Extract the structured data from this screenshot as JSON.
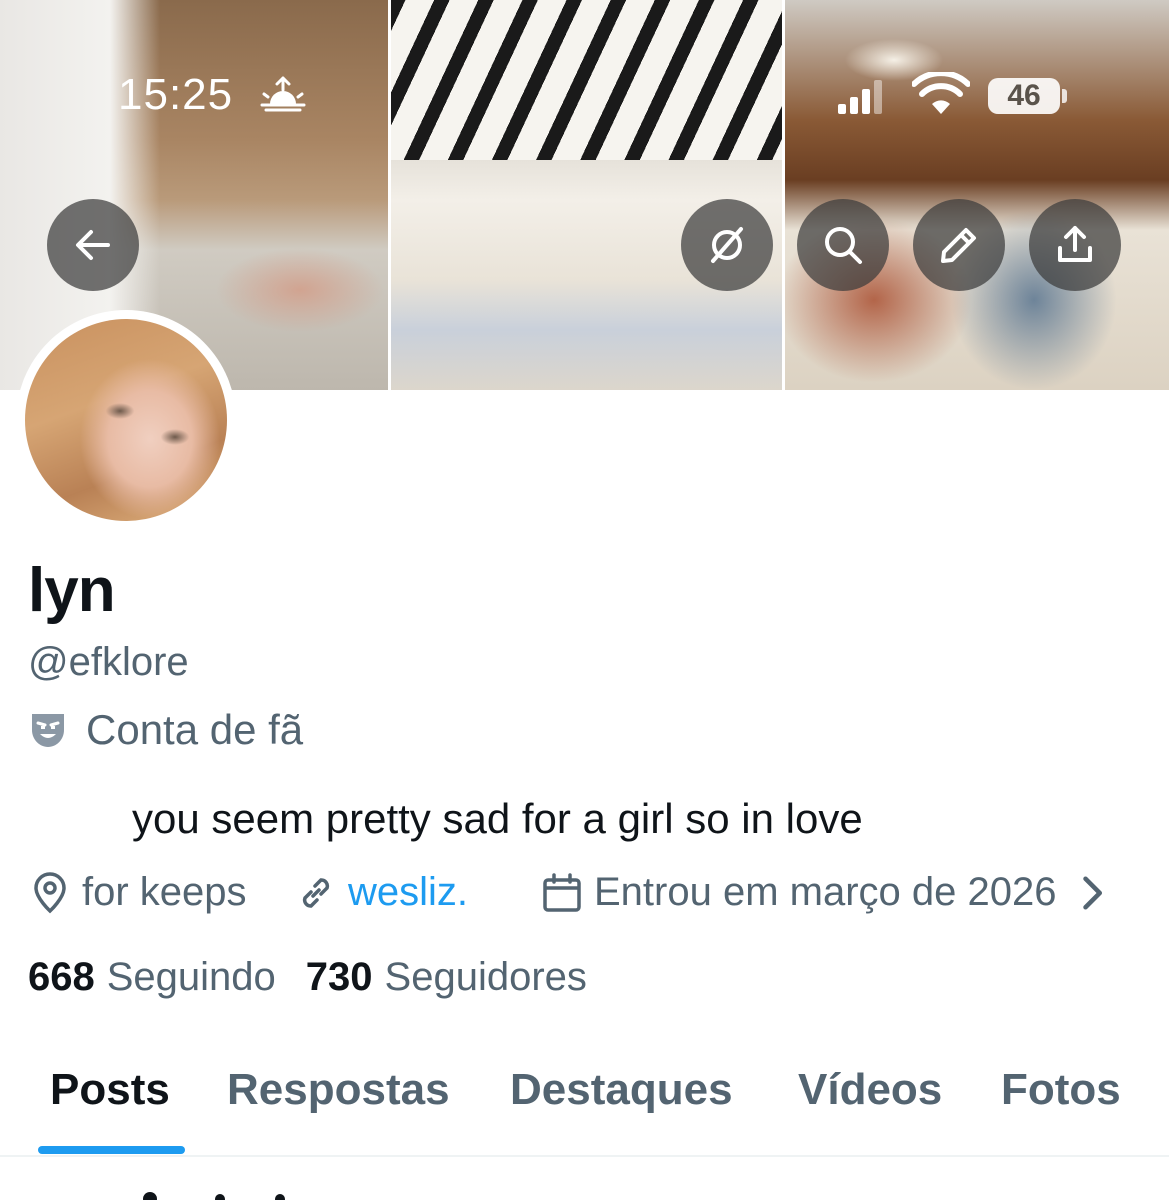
{
  "status_bar": {
    "time": "15:25",
    "battery": "46",
    "icons": [
      "sunrise-icon",
      "cellular-signal-icon",
      "wifi-icon",
      "battery-icon"
    ]
  },
  "header_actions": {
    "icons": [
      "back-arrow-icon",
      "grok-icon",
      "search-icon",
      "edit-pencil-icon",
      "share-icon"
    ]
  },
  "profile": {
    "display_name": "lyn",
    "handle": "@efklore",
    "category": "Conta de fã",
    "category_icon": "theater-mask-icon",
    "bio": "you seem pretty sad for a girl so in love",
    "location": "for keeps",
    "website": "wesliz.",
    "joined": "Entrou em março de 2026",
    "following_count": "668",
    "following_label": "Seguindo",
    "followers_count": "730",
    "followers_label": "Seguidores"
  },
  "tabs": [
    {
      "label": "Posts",
      "active": true
    },
    {
      "label": "Respostas",
      "active": false
    },
    {
      "label": "Destaques",
      "active": false
    },
    {
      "label": "Vídeos",
      "active": false
    },
    {
      "label": "Fotos",
      "active": false
    }
  ],
  "colors": {
    "accent": "#1d9bf0",
    "text_primary": "#0f1419",
    "text_secondary": "#536471"
  }
}
